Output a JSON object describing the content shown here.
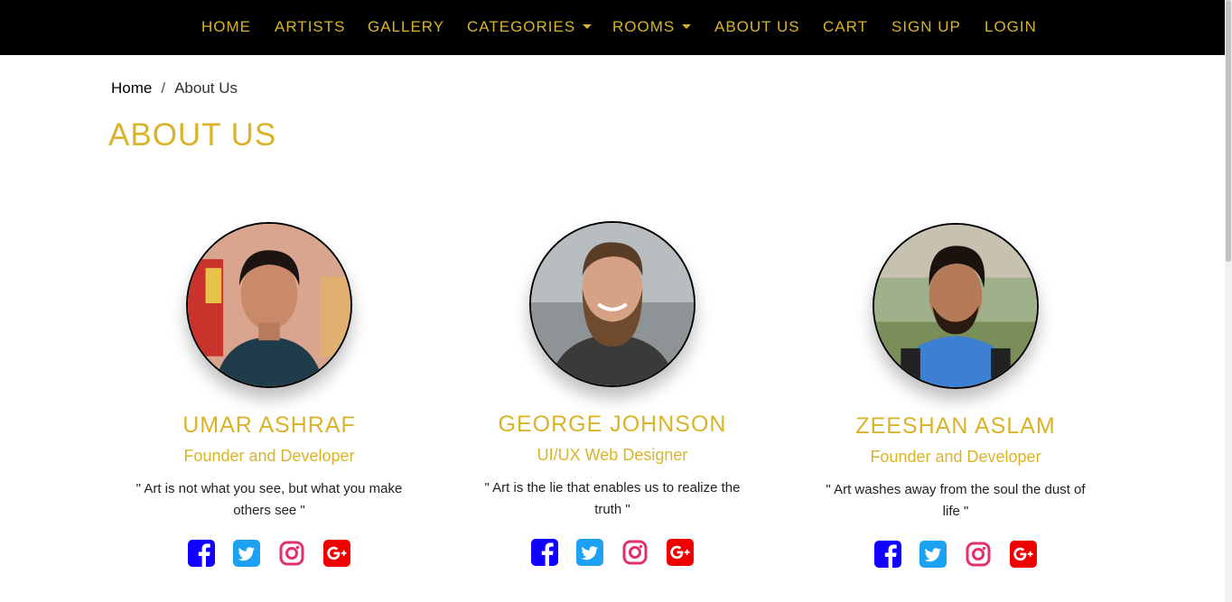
{
  "nav": {
    "items": [
      {
        "label": "HOME"
      },
      {
        "label": "ARTISTS"
      },
      {
        "label": "GALLERY"
      },
      {
        "label": "CATEGORIES"
      },
      {
        "label": "ROOMS"
      },
      {
        "label": "ABOUT US"
      },
      {
        "label": "CART"
      },
      {
        "label": "SIGN UP"
      },
      {
        "label": "LOGIN"
      }
    ]
  },
  "breadcrumb": {
    "home": "Home",
    "separator": "/",
    "current": "About Us"
  },
  "page": {
    "title": "ABOUT US"
  },
  "team": [
    {
      "name": "UMAR  ASHRAF",
      "role": "Founder and Developer",
      "quote": "\" Art is not what you see, but what you make others see \""
    },
    {
      "name": "GEORGE  JOHNSON",
      "role": "UI/UX Web Designer",
      "quote": "\" Art is the lie that enables us to realize the truth \""
    },
    {
      "name": "ZEESHAN  ASLAM",
      "role": "Founder and Developer",
      "quote": "\" Art washes away from the soul the dust of life \""
    }
  ],
  "colors": {
    "accent": "#d9b42b",
    "navbar_bg": "#000000",
    "facebook": "#1100ff",
    "twitter": "#1da1f2",
    "instagram": "#e1306c",
    "google_plus": "#ee0000"
  },
  "icons": [
    "facebook-icon",
    "twitter-icon",
    "instagram-icon",
    "google-plus-icon"
  ]
}
